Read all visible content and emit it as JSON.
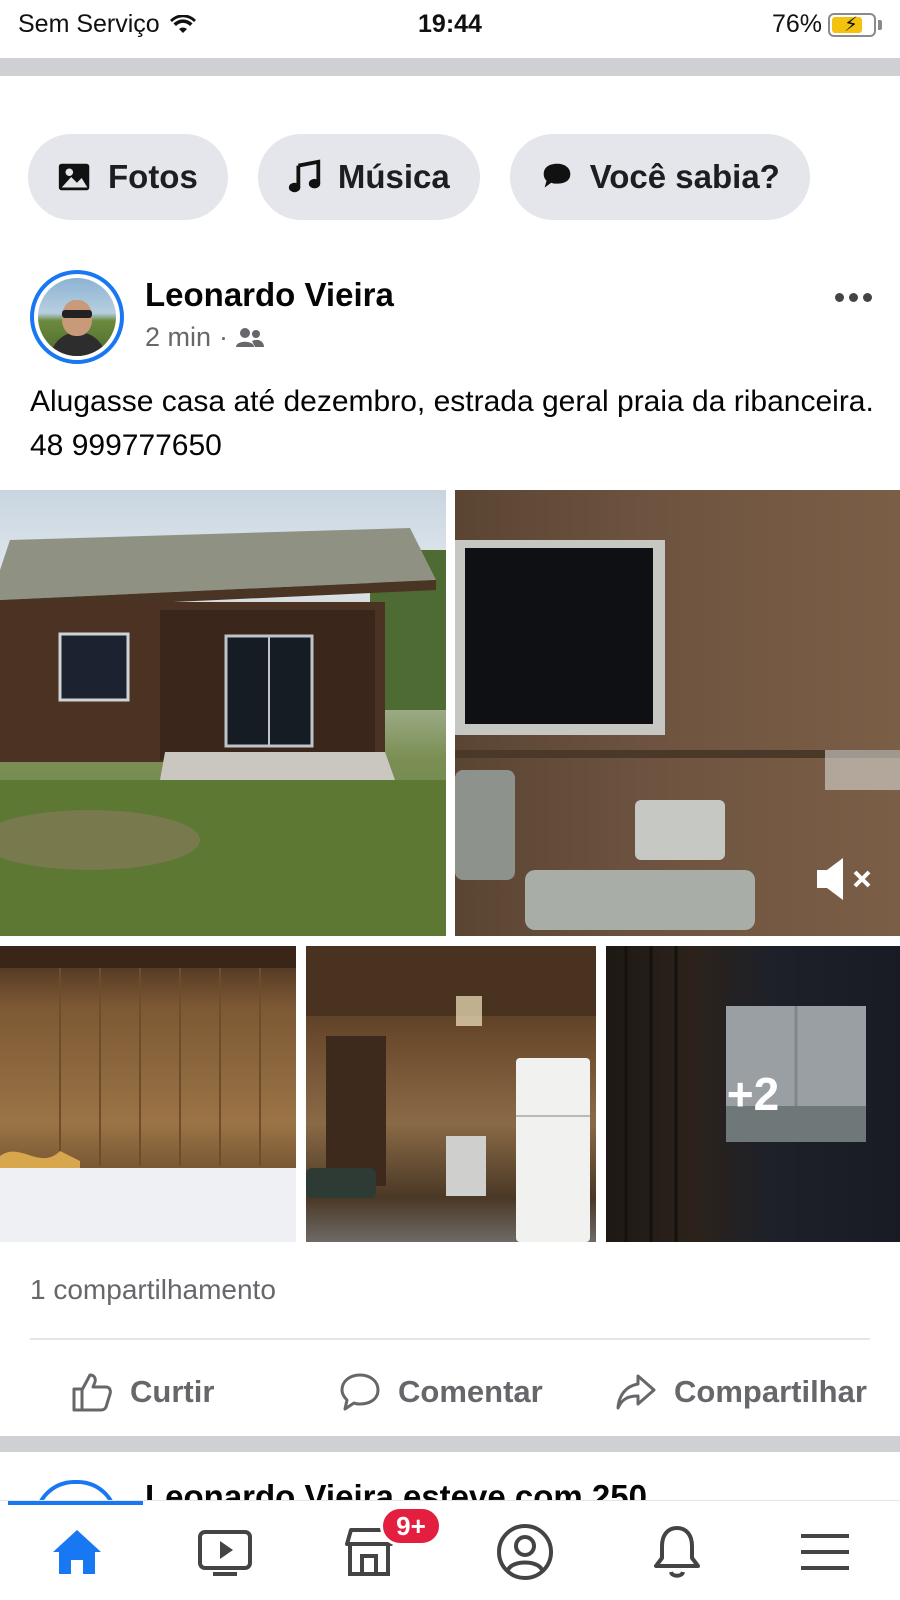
{
  "status_bar": {
    "carrier": "Sem Serviço",
    "time": "19:44",
    "battery": "76%",
    "battery_level": 0.76
  },
  "chips": [
    {
      "label": "Fotos",
      "icon": "photo-icon"
    },
    {
      "label": "Música",
      "icon": "music-note-icon"
    },
    {
      "label": "Você sabia?",
      "icon": "chat-bubble-icon"
    }
  ],
  "post": {
    "author": "Leonardo Vieira",
    "time": "2 min",
    "meta_separator": "·",
    "audience_icon": "friends-icon",
    "text": "Alugasse casa até dezembro, estrada geral praia da ribanceira. 48 999777650",
    "more_photos": "+2",
    "shares": "1 compartilhamento",
    "actions": {
      "like": "Curtir",
      "comment": "Comentar",
      "share": "Compartilhar"
    }
  },
  "next_post_peek": {
    "text": "Leonardo Vieira esteve com 250"
  },
  "tabbar": {
    "tabs": [
      "home-icon",
      "video-icon",
      "marketplace-icon",
      "profile-icon",
      "bell-icon",
      "menu-icon"
    ],
    "badge": "9+"
  },
  "colors": {
    "accent": "#1877f2",
    "badge": "#e41e3f",
    "chip_bg": "#e4e6eb",
    "secondary_text": "#65676b"
  }
}
